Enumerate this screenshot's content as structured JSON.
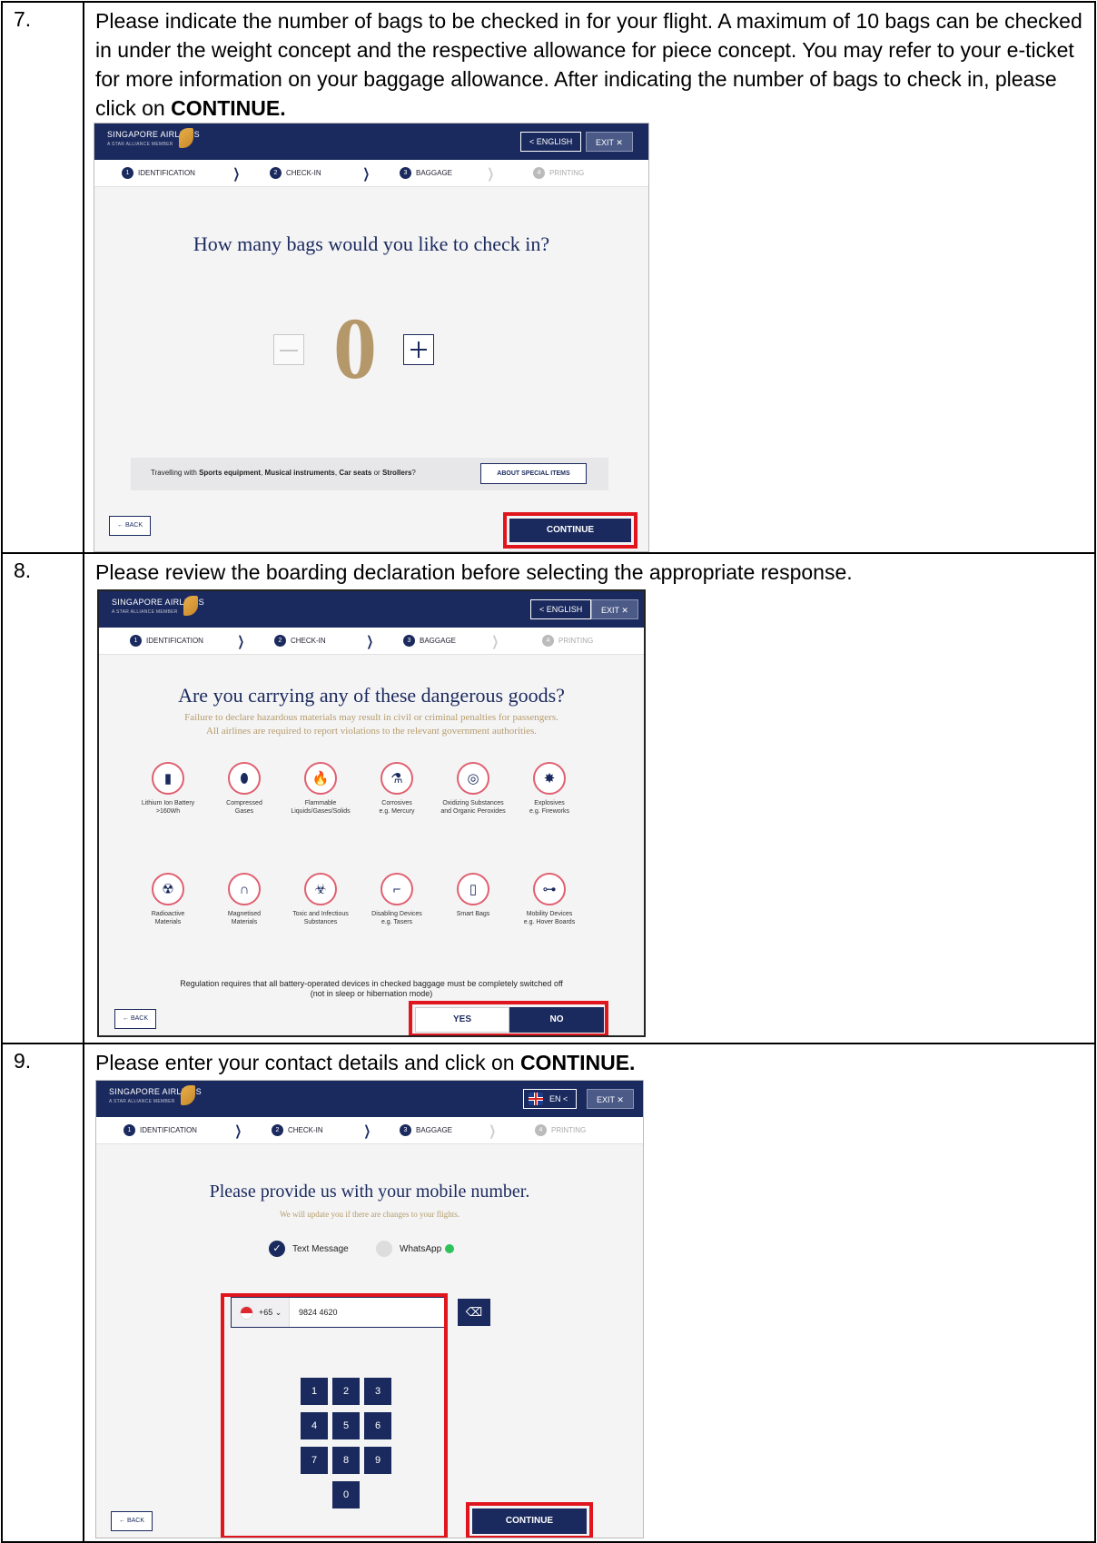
{
  "steps": [
    {
      "num": "7.",
      "text": "Please indicate the number of bags to be checked in for your flight. A maximum of 10 bags can be checked in under the weight concept and the respective allowance for piece concept. You may refer to your e-ticket for more information on your baggage allowance. After indicating the number of bags to check in, please click on ",
      "bold": "CONTINUE.",
      "screen": {
        "logo": "SINGAPORE AIRLINES",
        "logo_sub": "A STAR ALLIANCE MEMBER",
        "lang": "< ENGLISH",
        "exit": "EXIT ✕",
        "progress": [
          "IDENTIFICATION",
          "CHECK-IN",
          "BAGGAGE",
          "PRINTING"
        ],
        "question": "How many bags would you like to check in?",
        "bag_count": "0",
        "special_prefix": "Travelling with ",
        "special_items": [
          "Sports equipment",
          "Musical instruments",
          "Car seats",
          "Strollers"
        ],
        "special_join_comma": ", ",
        "special_join_or": " or ",
        "special_suffix": "?",
        "about_btn": "ABOUT SPECIAL ITEMS",
        "back": "← BACK",
        "continue": "CONTINUE"
      }
    },
    {
      "num": "8.",
      "text": "Please review the boarding declaration before selecting the appropriate response.",
      "screen": {
        "logo": "SINGAPORE AIRLINES",
        "logo_sub": "A STAR ALLIANCE MEMBER",
        "lang": "< ENGLISH",
        "exit": "EXIT ✕",
        "progress": [
          "IDENTIFICATION",
          "CHECK-IN",
          "BAGGAGE",
          "PRINTING"
        ],
        "question": "Are you carrying any of these dangerous goods?",
        "warning_1": "Failure to declare hazardous materials may result in civil or criminal penalties for passengers.",
        "warning_2": "All airlines are required to report violations to the relevant government authorities.",
        "items": [
          {
            "l1": "Lithium Ion Battery",
            "l2": ">160Wh",
            "icon": "battery-icon",
            "glyph": "▮"
          },
          {
            "l1": "Compressed",
            "l2": "Gases",
            "icon": "gas-cylinder-icon",
            "glyph": "⬮"
          },
          {
            "l1": "Flammable",
            "l2": "Liquids/Gases/Solids",
            "icon": "flame-icon",
            "glyph": "🔥"
          },
          {
            "l1": "Corrosives",
            "l2": "e.g. Mercury",
            "icon": "corrosive-icon",
            "glyph": "⚗"
          },
          {
            "l1": "Oxidizing Substances",
            "l2": "and Organic Peroxides",
            "icon": "oxidizer-icon",
            "glyph": "◎"
          },
          {
            "l1": "Explosives",
            "l2": "e.g. Fireworks",
            "icon": "explosion-icon",
            "glyph": "✸"
          },
          {
            "l1": "Radioactive",
            "l2": "Materials",
            "icon": "radiation-icon",
            "glyph": "☢"
          },
          {
            "l1": "Magnetised",
            "l2": "Materials",
            "icon": "magnet-icon",
            "glyph": "∩"
          },
          {
            "l1": "Toxic and Infectious",
            "l2": "Substances",
            "icon": "biohazard-icon",
            "glyph": "☣"
          },
          {
            "l1": "Disabling Devices",
            "l2": "e.g. Tasers",
            "icon": "taser-icon",
            "glyph": "⌐"
          },
          {
            "l1": "Smart Bags",
            "l2": "",
            "icon": "smart-bag-icon",
            "glyph": "▯"
          },
          {
            "l1": "Mobility Devices",
            "l2": "e.g. Hover Boards",
            "icon": "hoverboard-icon",
            "glyph": "⊶"
          }
        ],
        "regulation_1": "Regulation requires that all battery-operated devices in checked baggage must be completely switched off",
        "regulation_2": "(not in sleep or hibernation mode)",
        "back": "← BACK",
        "yes": "YES",
        "no": "NO"
      }
    },
    {
      "num": "9.",
      "text": "Please enter your contact details and click on ",
      "bold": "CONTINUE.",
      "screen": {
        "logo": "SINGAPORE AIRLINES",
        "logo_sub": "A STAR ALLIANCE MEMBER",
        "lang": "EN <",
        "exit": "EXIT ✕",
        "progress": [
          "IDENTIFICATION",
          "CHECK-IN",
          "BAGGAGE",
          "PRINTING"
        ],
        "question": "Please provide us with your mobile number.",
        "subtitle": "We will update you if there are changes to your flights.",
        "opt_text": "Text Message",
        "opt_whatsapp": "WhatsApp",
        "country_code": "+65 ⌄",
        "phone": "9824 4620",
        "keys": [
          "1",
          "2",
          "3",
          "4",
          "5",
          "6",
          "7",
          "8",
          "9",
          "0"
        ],
        "back": "← BACK",
        "continue": "CONTINUE"
      }
    }
  ]
}
